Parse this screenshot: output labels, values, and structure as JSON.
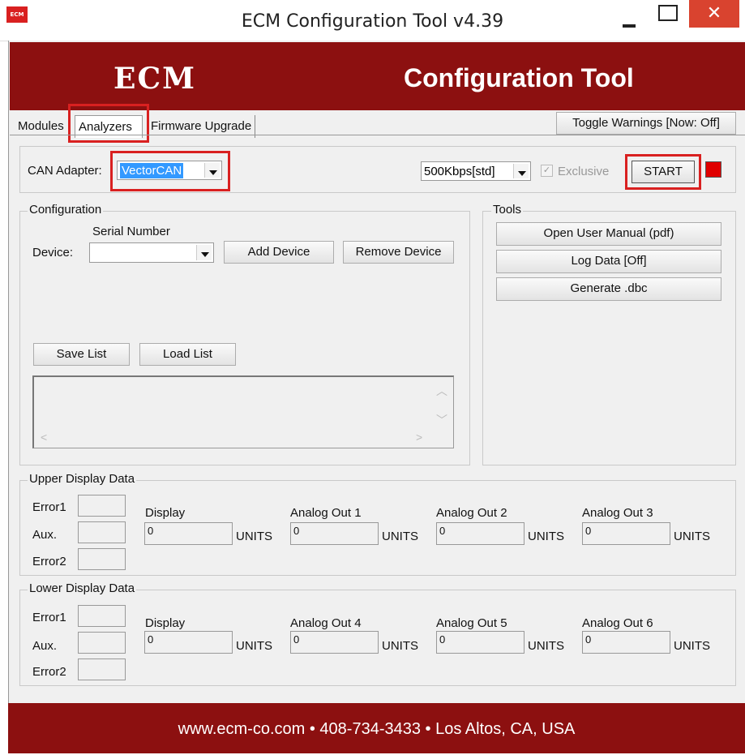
{
  "window": {
    "title": "ECM Configuration Tool v4.39",
    "icon_text": "ECM",
    "close_glyph": "✕"
  },
  "banner": {
    "brand": "ECM",
    "title": "Configuration Tool"
  },
  "tabs": [
    {
      "label": "Modules"
    },
    {
      "label": "Analyzers"
    },
    {
      "label": "Firmware Upgrade"
    }
  ],
  "toggle_warnings_label": "Toggle Warnings [Now: Off]",
  "adapter": {
    "label": "CAN Adapter:",
    "value": "VectorCAN",
    "baud_value": "500Kbps[std]",
    "exclusive_label": "Exclusive",
    "exclusive_checked": true,
    "start_label": "START",
    "status_color": "#e00000"
  },
  "configuration": {
    "legend": "Configuration",
    "serial_label": "Serial Number",
    "device_label": "Device:",
    "device_value": "",
    "add_label": "Add Device",
    "remove_label": "Remove Device",
    "save_label": "Save List",
    "load_label": "Load List"
  },
  "tools": {
    "legend": "Tools",
    "open_manual": "Open User Manual (pdf)",
    "log_data": "Log Data [Off]",
    "generate": "Generate .dbc"
  },
  "upper": {
    "legend": "Upper Display Data",
    "error1": "Error1",
    "aux": "Aux.",
    "error2": "Error2",
    "cols": [
      {
        "title": "Display",
        "value": "0",
        "units": "UNITS"
      },
      {
        "title": "Analog Out 1",
        "value": "0",
        "units": "UNITS"
      },
      {
        "title": "Analog Out 2",
        "value": "0",
        "units": "UNITS"
      },
      {
        "title": "Analog Out 3",
        "value": "0",
        "units": "UNITS"
      }
    ]
  },
  "lower": {
    "legend": "Lower Display Data",
    "error1": "Error1",
    "aux": "Aux.",
    "error2": "Error2",
    "cols": [
      {
        "title": "Display",
        "value": "0",
        "units": "UNITS"
      },
      {
        "title": "Analog Out 4",
        "value": "0",
        "units": "UNITS"
      },
      {
        "title": "Analog Out 5",
        "value": "0",
        "units": "UNITS"
      },
      {
        "title": "Analog Out 6",
        "value": "0",
        "units": "UNITS"
      }
    ]
  },
  "footer": "www.ecm-co.com • 408-734-3433 • Los Altos, CA, USA",
  "colors": {
    "brand_red": "#8c1010",
    "highlight_red": "#d92020",
    "selection_blue": "#3399ff"
  }
}
